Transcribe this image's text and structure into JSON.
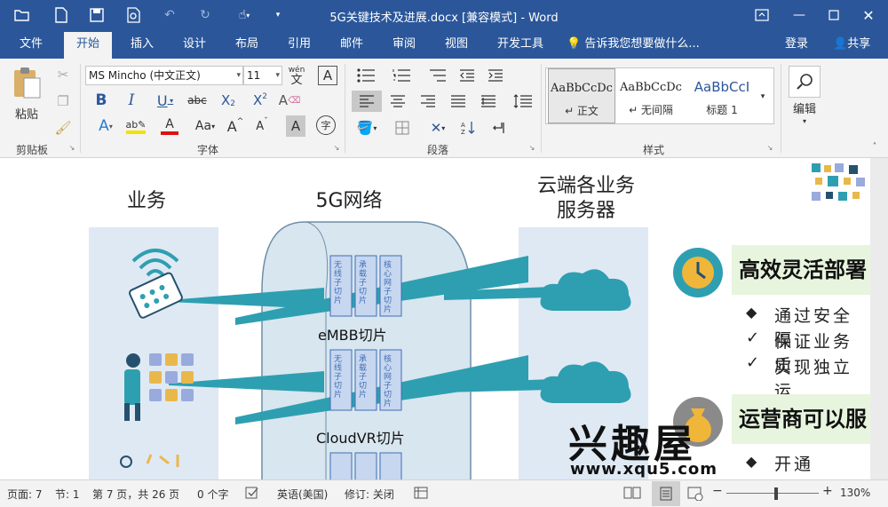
{
  "window": {
    "title": "5G关键技术及进展.docx [兼容模式] - Word",
    "colors": {
      "brand": "#2b579a",
      "ribbon": "#f3f3f3",
      "slice_teal": "#2e9fb1",
      "column_blue": "#dfe9f4",
      "heading_green": "#e7f5de"
    }
  },
  "quick_access": [
    "file-open-icon",
    "new-document-icon",
    "save-icon",
    "print-preview-icon",
    "undo-icon",
    "redo-icon",
    "touch-mode-icon",
    "customize-arrow-icon"
  ],
  "tabs": [
    "文件",
    "开始",
    "插入",
    "设计",
    "布局",
    "引用",
    "邮件",
    "审阅",
    "视图",
    "开发工具"
  ],
  "active_tab": "开始",
  "tell_me": "告诉我您想要做什么...",
  "account": {
    "login": "登录",
    "share": "共享"
  },
  "ribbon": {
    "clipboard": {
      "paste": "粘贴",
      "group": "剪贴板"
    },
    "font": {
      "name": "MS Mincho (中文正文)",
      "size": "11",
      "group": "字体",
      "phonetic_top": "wén",
      "phonetic_bottom": "文",
      "border_char": "A",
      "strike": "abc",
      "enclose": "字"
    },
    "paragraph": {
      "group": "段落"
    },
    "styles": {
      "group": "样式",
      "items": [
        {
          "sample": "AaBbCcDc",
          "name": "↵ 正文"
        },
        {
          "sample": "AaBbCcDc",
          "name": "↵ 无间隔"
        },
        {
          "sample": "AaBbCcI",
          "name": "标题 1"
        }
      ]
    },
    "editing": {
      "label": "编辑"
    }
  },
  "document": {
    "col_business": "业务",
    "col_network": "5G网络",
    "col_cloud_line1": "云端各业务",
    "col_cloud_line2": "服务器",
    "slices": [
      {
        "name": "eMBB切片",
        "panels": [
          "无线子切片",
          "承载子切片",
          "核心网子切片"
        ]
      },
      {
        "name": "CloudVR切片",
        "panels": [
          "无线子切片",
          "承载子切片",
          "核心网子切片"
        ]
      }
    ],
    "section1": {
      "heading": "高效灵活部署",
      "bullets": [
        {
          "mark": "◆",
          "text": "通过安全隔"
        },
        {
          "mark": "✓",
          "text": "保证业务质"
        },
        {
          "mark": "✓",
          "text": "实现独立运"
        }
      ]
    },
    "section2": {
      "heading": "运营商可以服",
      "bullet_mark": "◆",
      "bullet_text": "开通"
    },
    "watermark": {
      "brand": "兴趣屋",
      "url": "www.xqu5.com"
    }
  },
  "status": {
    "page": "页面: 7",
    "section": "节: 1",
    "page_count": "第 7 页，共 26 页",
    "words": "0 个字",
    "language": "英语(美国)",
    "track": "修订: 关闭",
    "zoom": "130%",
    "zoom_level": 1.3
  }
}
